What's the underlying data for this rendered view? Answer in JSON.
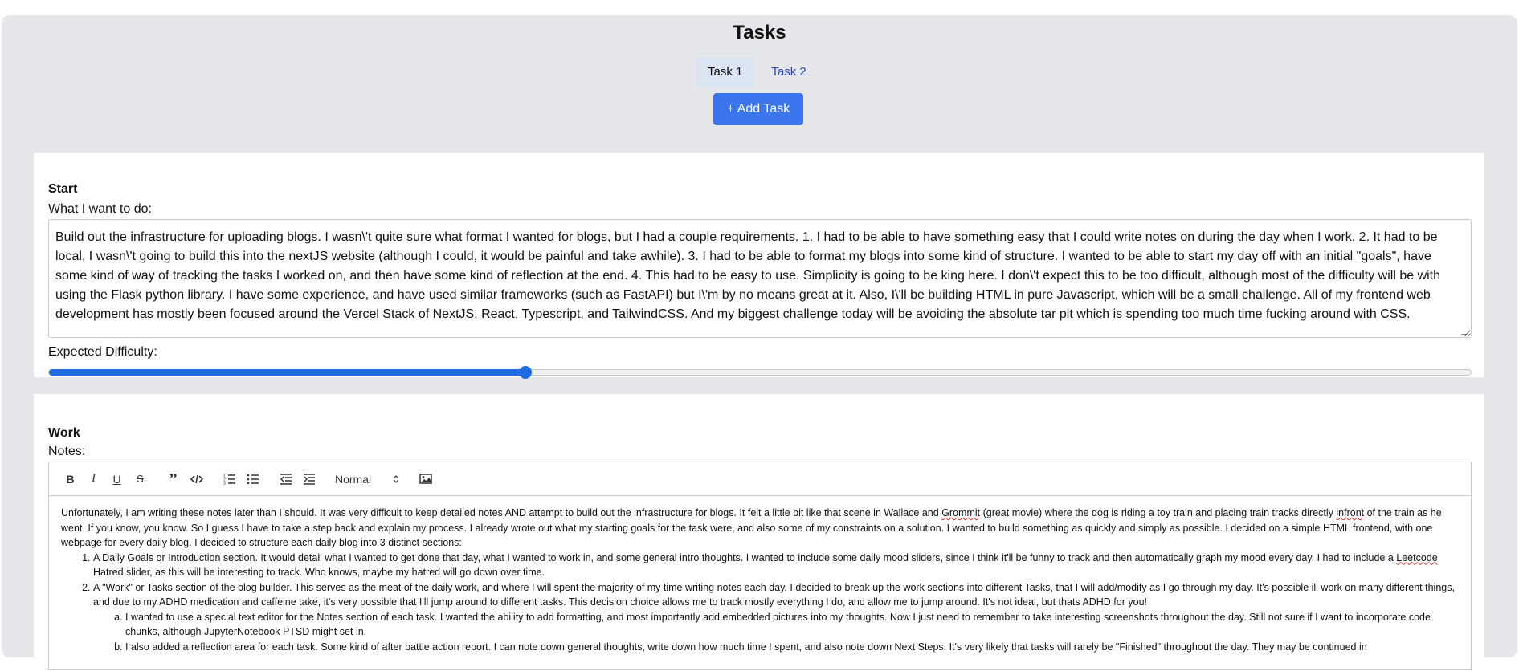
{
  "page": {
    "title": "Tasks"
  },
  "tabs": [
    {
      "label": "Task 1",
      "active": true
    },
    {
      "label": "Task 2",
      "active": false
    }
  ],
  "add_task_label": "+ Add Task",
  "start": {
    "heading": "Start",
    "goal_label": "What I want to do:",
    "goal_text": "Build out the infrastructure for uploading blogs. I wasn\\'t quite sure what format I wanted for blogs, but I had a couple requirements. 1. I had to be able to have something easy that I could write notes on during the day when I work. 2. It had to be local, I wasn\\'t going to build this into the nextJS website (although I could, it would be painful and take awhile). 3. I had to be able to format my blogs into some kind of structure. I wanted to be able to start my day off with an initial \"goals\", have some kind of way of tracking the tasks I worked on, and then have some kind of reflection at the end. 4. This had to be easy to use. Simplicity is going to be king here. I don\\'t expect this to be too difficult, although most of the difficulty will be with using the Flask python library. I have some experience, and have used similar frameworks (such as FastAPI) but I\\'m by no means great at it. Also, I\\'ll be building HTML in pure Javascript, which will be a small challenge. All of my frontend web development has mostly been focused around the Vercel Stack of NextJS, React, Typescript, and TailwindCSS. And my biggest challenge today will be avoiding the absolute tar pit which is spending too much time fucking around with CSS.",
    "difficulty_label": "Expected Difficulty:",
    "difficulty_value": 0.335
  },
  "work": {
    "heading": "Work",
    "notes_label": "Notes:",
    "toolbar": {
      "buttons": [
        "bold-icon",
        "italic-icon",
        "underline-icon",
        "strike-icon",
        "blockquote-icon",
        "code-icon",
        "ordered-list-icon",
        "bullet-list-icon",
        "outdent-icon",
        "indent-icon"
      ],
      "format_select": "Normal",
      "image_button": "image-icon"
    },
    "notes": {
      "intro_1": "Unfortunately, I am writing these notes later than I should. It was very difficult to keep detailed notes AND attempt to build out the infrastructure for blogs. It felt a little bit like that scene in Wallace and ",
      "intro_grommit": "Grommit",
      "intro_2": " (great movie) where the dog is riding a toy train and placing train tracks directly ",
      "intro_infront": "infront",
      "intro_3": " of the train as he went. If you know, you know. So I guess I have to take a step back and explain my process. I already wrote out what my starting goals for the task were, and also some of my constraints on a solution. I wanted to build something as quickly and simply as possible. I decided on a simple HTML frontend, with one webpage for every daily blog. I decided to structure each daily blog into 3 distinct sections:",
      "item1_a": "A Daily Goals or Introduction section. It would detail what I wanted to get done that day, what I wanted to work in, and some general intro thoughts. I wanted to include some daily mood sliders, since I think it'll be funny to track and then automatically graph my mood every day. I had to include a ",
      "item1_leetcode": "Leetcode",
      "item1_b": " Hatred slider, as this will be interesting to track. Who knows, maybe my hatred will go down over time.",
      "item2": "A \"Work\" or Tasks section of the blog builder. This serves as the meat of the daily work, and where I will spent the majority of my time writing notes each day. I decided to break up the work sections into different Tasks, that I will add/modify as I go through my day. It's possible ill work on many different things, and due to my ADHD medication and caffeine take, it's very possible that I'll jump around to different tasks. This decision choice allows me to track mostly everything I do, and allow me to jump around. It's not ideal, but thats ADHD for you!",
      "item2a": "I wanted to use a special text editor for the Notes section of each task. I wanted the ability to add formatting, and most importantly add embedded pictures into my thoughts. Now I just need to remember to take interesting screenshots throughout the day. Still not sure if I want to incorporate code chunks, although JupyterNotebook PTSD might set in.",
      "item2b": "I also added a reflection area for each task. Some kind of after battle action report. I can note down general thoughts, write down how much time I spent, and also note down Next Steps. It's very likely that tasks will rarely be \"Finished\" throughout the day. They may be continued in"
    }
  }
}
